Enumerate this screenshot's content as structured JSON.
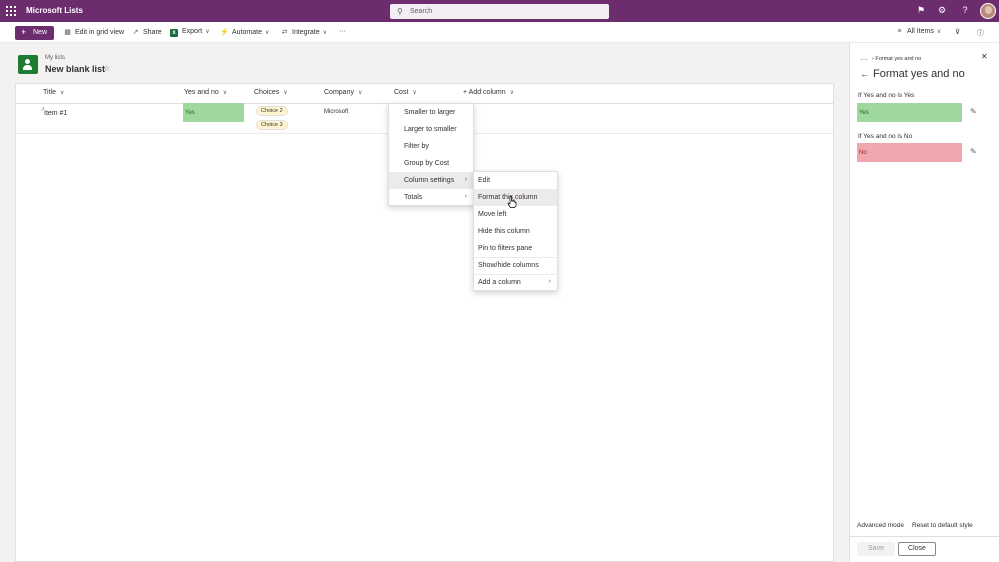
{
  "app": {
    "title": "Microsoft Lists",
    "search_placeholder": "Search",
    "brand_color": "#6c2d6e"
  },
  "topbar_icons": [
    "flag-icon",
    "gear-icon",
    "help-icon"
  ],
  "commandbar": {
    "new_label": "New",
    "edit_grid_label": "Edit in grid view",
    "share_label": "Share",
    "export_label": "Export",
    "automate_label": "Automate",
    "integrate_label": "Integrate",
    "more_label": "···",
    "view_label": "All Items"
  },
  "list": {
    "breadcrumb": "My lists",
    "title": "New blank list",
    "columns": [
      "Title",
      "Yes and no",
      "Choices",
      "Company",
      "Cost",
      "Add column"
    ],
    "rows": [
      {
        "title": "Item #1",
        "yes_and_no": "Yes",
        "choices": [
          "Choice 2",
          "Choice 3"
        ],
        "company": "Microsoft",
        "cost": ""
      }
    ]
  },
  "column_menu": {
    "items": [
      "Smaller to larger",
      "Larger to smaller",
      "Filter by",
      "Group by Cost",
      "Column settings",
      "Totals"
    ]
  },
  "column_settings_submenu": {
    "items": [
      "Edit",
      "Format this column",
      "Move left",
      "Hide this column",
      "Pin to filters pane",
      "Show/hide columns",
      "Add a column"
    ]
  },
  "format_panel": {
    "breadcrumb_dots": "···",
    "breadcrumb": "Format yes and no",
    "title": "Format yes and no",
    "rules": [
      {
        "label": "If Yes and no is Yes",
        "value": "Yes",
        "color": "#9fd89f",
        "text_color": "#0e700e"
      },
      {
        "label": "If Yes and no is No",
        "value": "No",
        "color": "#f1a7af",
        "text_color": "#a4262c"
      }
    ],
    "advanced_mode": "Advanced mode",
    "reset": "Reset to default style",
    "save": "Save",
    "close": "Close"
  }
}
